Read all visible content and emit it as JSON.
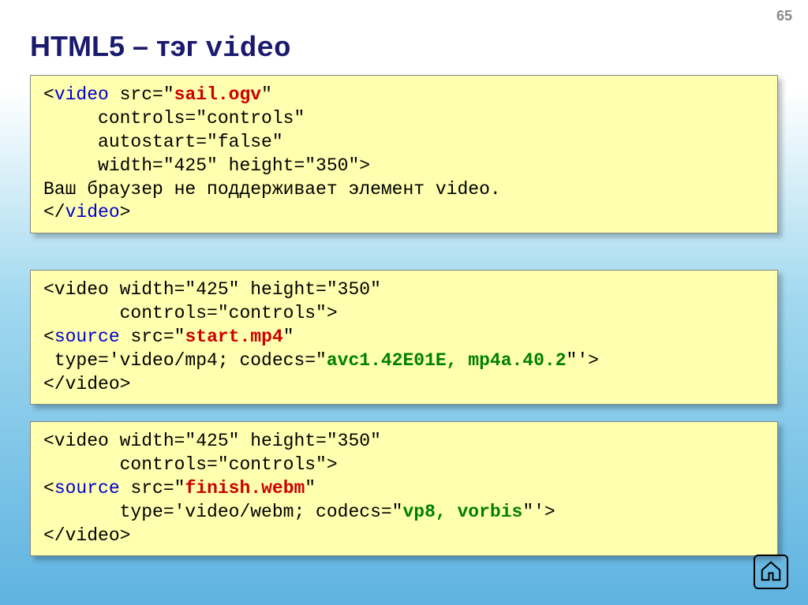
{
  "page_number": "65",
  "title_prefix": "HTML5 – тэг ",
  "title_mono": "video",
  "code1": {
    "l1a": "<",
    "l1b": "video",
    "l1c": " src=\"",
    "l1d": "sail.ogv",
    "l1e": "\"",
    "l2": "     controls=\"controls\"",
    "l3": "     autostart=\"false\"",
    "l4": "     width=\"425\" height=\"350\">",
    "l5": "Ваш браузер не поддерживает элемент video.",
    "l6a": "</",
    "l6b": "video",
    "l6c": ">"
  },
  "code2": {
    "l1": "<video width=\"425\" height=\"350\" ",
    "l2": "       controls=\"controls\">",
    "l3a": "<",
    "l3b": "source",
    "l3c": " src=\"",
    "l3d": "start.mp4",
    "l3e": "\"",
    "l4a": " type='video/mp4; codecs=\"",
    "l4b": "avc1.42E01E, mp4a.40.2",
    "l4c": "\"'>",
    "l5": "</video>"
  },
  "code3": {
    "l1": "<video width=\"425\" height=\"350\" ",
    "l2": "       controls=\"controls\">",
    "l3a": "<",
    "l3b": "source",
    "l3c": " src=\"",
    "l3d": "finish.webm",
    "l3e": "\"",
    "l4a": "       type='video/webm; codecs=\"",
    "l4b": "vp8, vorbis",
    "l4c": "\"'>",
    "l5": "</video>"
  }
}
